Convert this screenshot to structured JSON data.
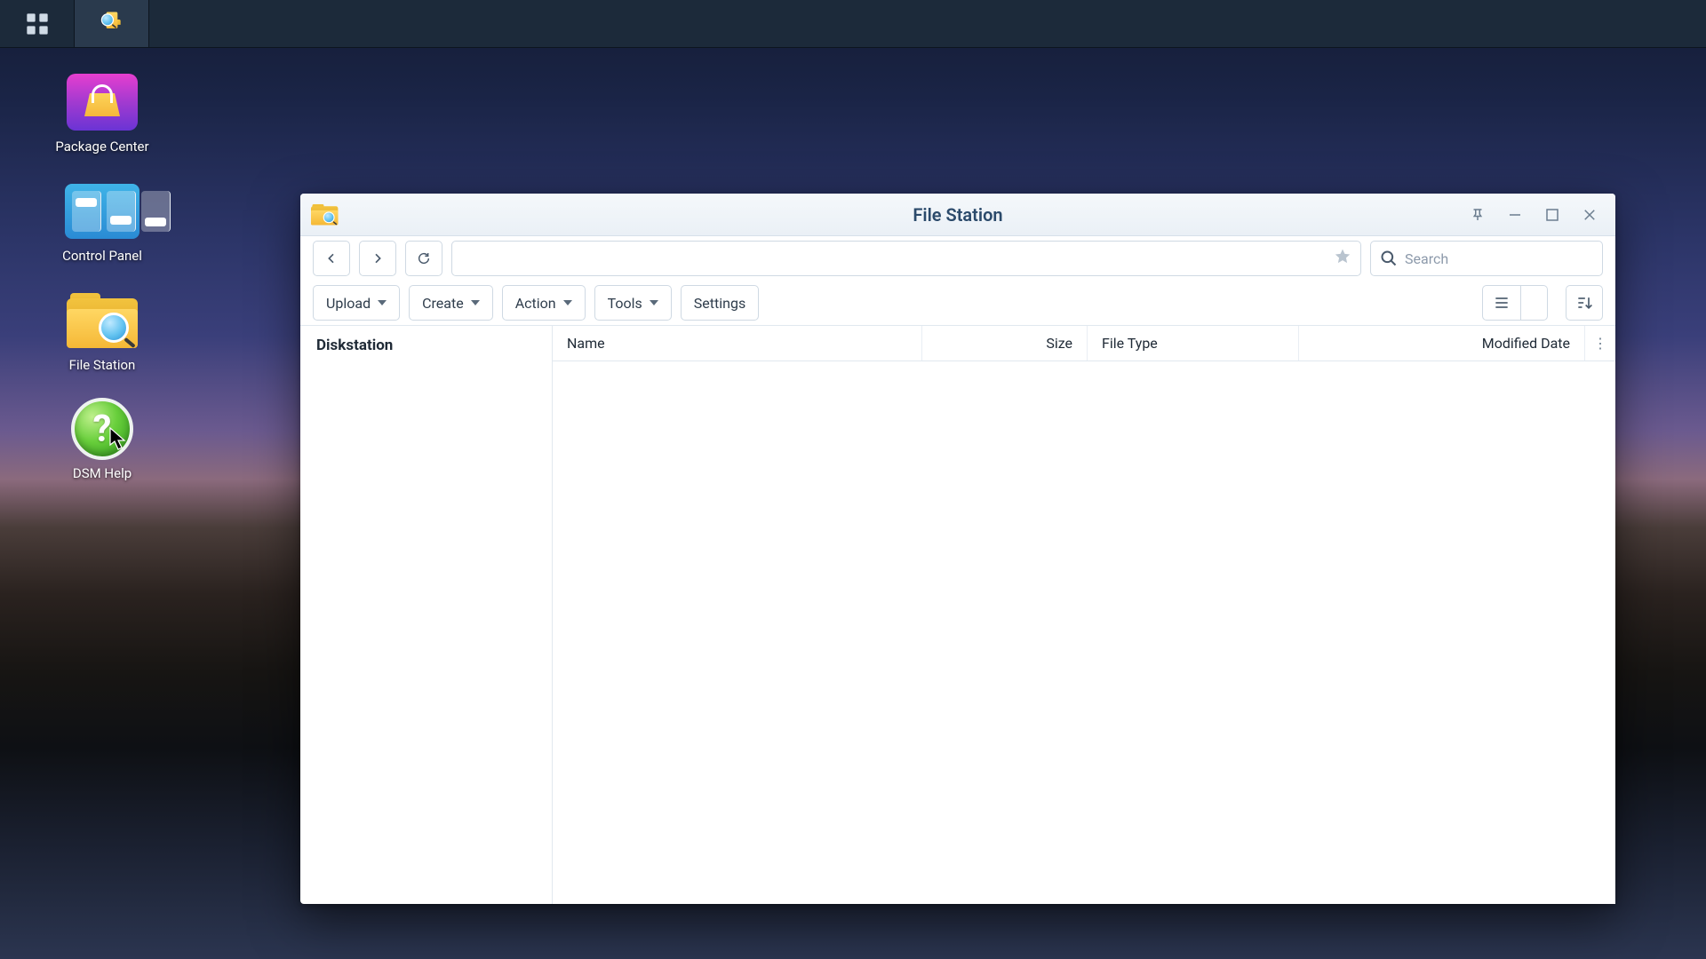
{
  "taskbar": {
    "items": [
      {
        "name": "apps-menu"
      },
      {
        "name": "file-station-task"
      }
    ]
  },
  "desktop": {
    "icons": [
      {
        "id": "package-center",
        "label": "Package Center"
      },
      {
        "id": "control-panel",
        "label": "Control Panel"
      },
      {
        "id": "file-station",
        "label": "File Station"
      },
      {
        "id": "dsm-help",
        "label": "DSM Help"
      }
    ]
  },
  "window": {
    "title": "File Station",
    "nav": {
      "path": "",
      "search_placeholder": "Search"
    },
    "toolbar": {
      "upload": "Upload",
      "create": "Create",
      "action": "Action",
      "tools": "Tools",
      "settings": "Settings"
    },
    "tree": {
      "root": "Diskstation"
    },
    "columns": {
      "name": "Name",
      "size": "Size",
      "type": "File Type",
      "modified": "Modified Date"
    },
    "rows": []
  }
}
